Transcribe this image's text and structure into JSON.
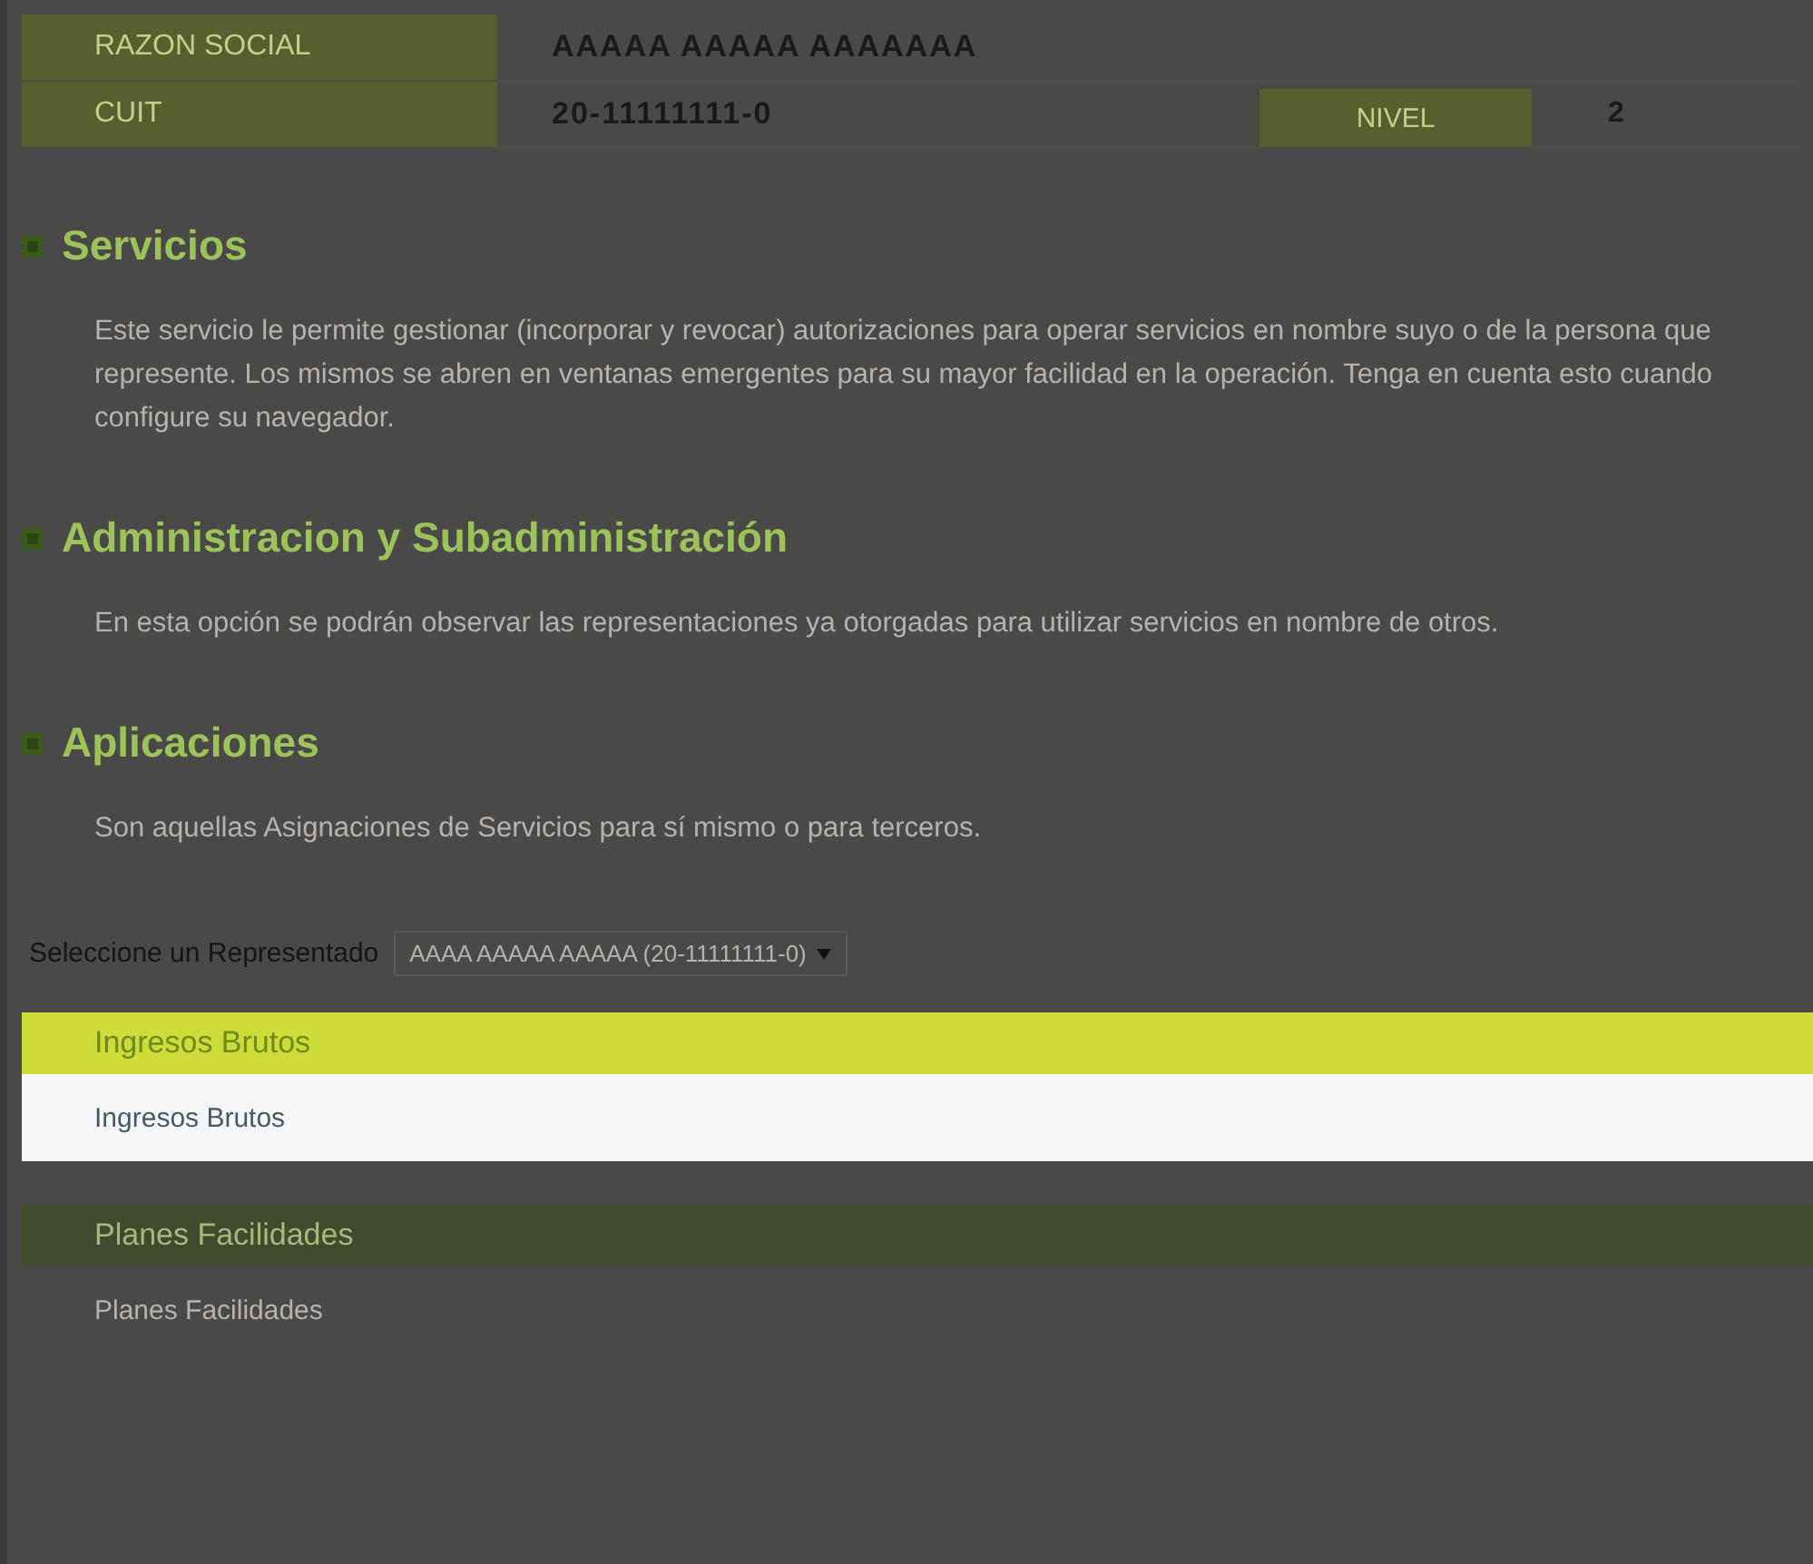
{
  "header": {
    "rows": [
      {
        "label": "RAZON SOCIAL",
        "value": "AAAAA  AAAAA  AAAAAAA"
      },
      {
        "label": "CUIT",
        "value": "20-11111111-0",
        "extra_label": "NIVEL",
        "extra_value": "2"
      }
    ]
  },
  "sections": [
    {
      "title": "Servicios",
      "text": "Este servicio le permite gestionar (incorporar y revocar) autorizaciones para operar servicios en nombre suyo o de la persona que represente. Los mismos se abren en ventanas emergentes para su mayor facilidad en la operación. Tenga en cuenta esto cuando configure su navegador."
    },
    {
      "title": "Administracion y Subadministración",
      "text": "En esta opción se podrán observar las representaciones ya otorgadas para utilizar servicios en nombre de otros."
    },
    {
      "title": "Aplicaciones",
      "text": "Son aquellas Asignaciones de Servicios para sí mismo o para terceros."
    }
  ],
  "selector": {
    "label": "Seleccione un Representado",
    "value": "AAAA  AAAAA  AAAAA (20-11111111-0)"
  },
  "groups": [
    {
      "title": "Ingresos Brutos",
      "highlighted": true,
      "items": [
        "Ingresos Brutos"
      ]
    },
    {
      "title": "Planes Facilidades",
      "highlighted": false,
      "items": [
        "Planes Facilidades"
      ]
    }
  ]
}
